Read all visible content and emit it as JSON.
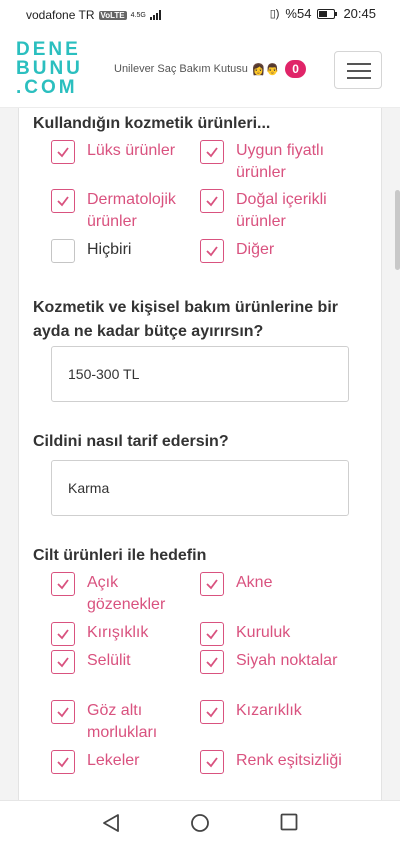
{
  "status_bar": {
    "carrier": "vodafone TR",
    "volte": "VoLTE",
    "network": "4.5G",
    "battery": "%54",
    "time": "20:45"
  },
  "header": {
    "logo_lines": [
      "DENE",
      "BUNU",
      ".COM"
    ],
    "kit_label": "Unilever Saç Bakım Kutusu",
    "kit_emoji": "👩👨",
    "cart_count": "0"
  },
  "form": {
    "cosmetic": {
      "question": "Kullandığın kozmetik ürünleri...",
      "options": [
        {
          "label": "Lüks ürünler",
          "checked": true
        },
        {
          "label": "Uygun fiyatlı ürünler",
          "checked": true
        },
        {
          "label": "Dermatolojik ürünler",
          "checked": true
        },
        {
          "label": "Doğal içerikli ürünler",
          "checked": true
        },
        {
          "label": "Hiçbiri",
          "checked": false
        },
        {
          "label": "Diğer",
          "checked": true
        }
      ]
    },
    "budget": {
      "question": "Kozmetik ve kişisel bakım ürünlerine bir ayda ne kadar bütçe ayırırsın?",
      "value": "150-300 TL"
    },
    "skin": {
      "question": "Cildini nasıl tarif edersin?",
      "value": "Karma"
    },
    "goal": {
      "question": "Cilt ürünleri ile hedefin",
      "options": [
        {
          "label": "Açık gözenekler",
          "checked": true
        },
        {
          "label": "Akne",
          "checked": true
        },
        {
          "label": "Kırışıklık",
          "checked": true
        },
        {
          "label": "Kuruluk",
          "checked": true
        },
        {
          "label": "Selülit",
          "checked": true
        },
        {
          "label": "Siyah noktalar",
          "checked": true
        },
        {
          "label": "Göz altı morlukları",
          "checked": true
        },
        {
          "label": "Kızarıklık",
          "checked": true
        },
        {
          "label": "Lekeler",
          "checked": true
        },
        {
          "label": "Renk eşitsizliği",
          "checked": true
        }
      ]
    }
  },
  "colors": {
    "accent": "#d9527f",
    "brand": "#2bbfbf",
    "badge": "#e02468"
  }
}
